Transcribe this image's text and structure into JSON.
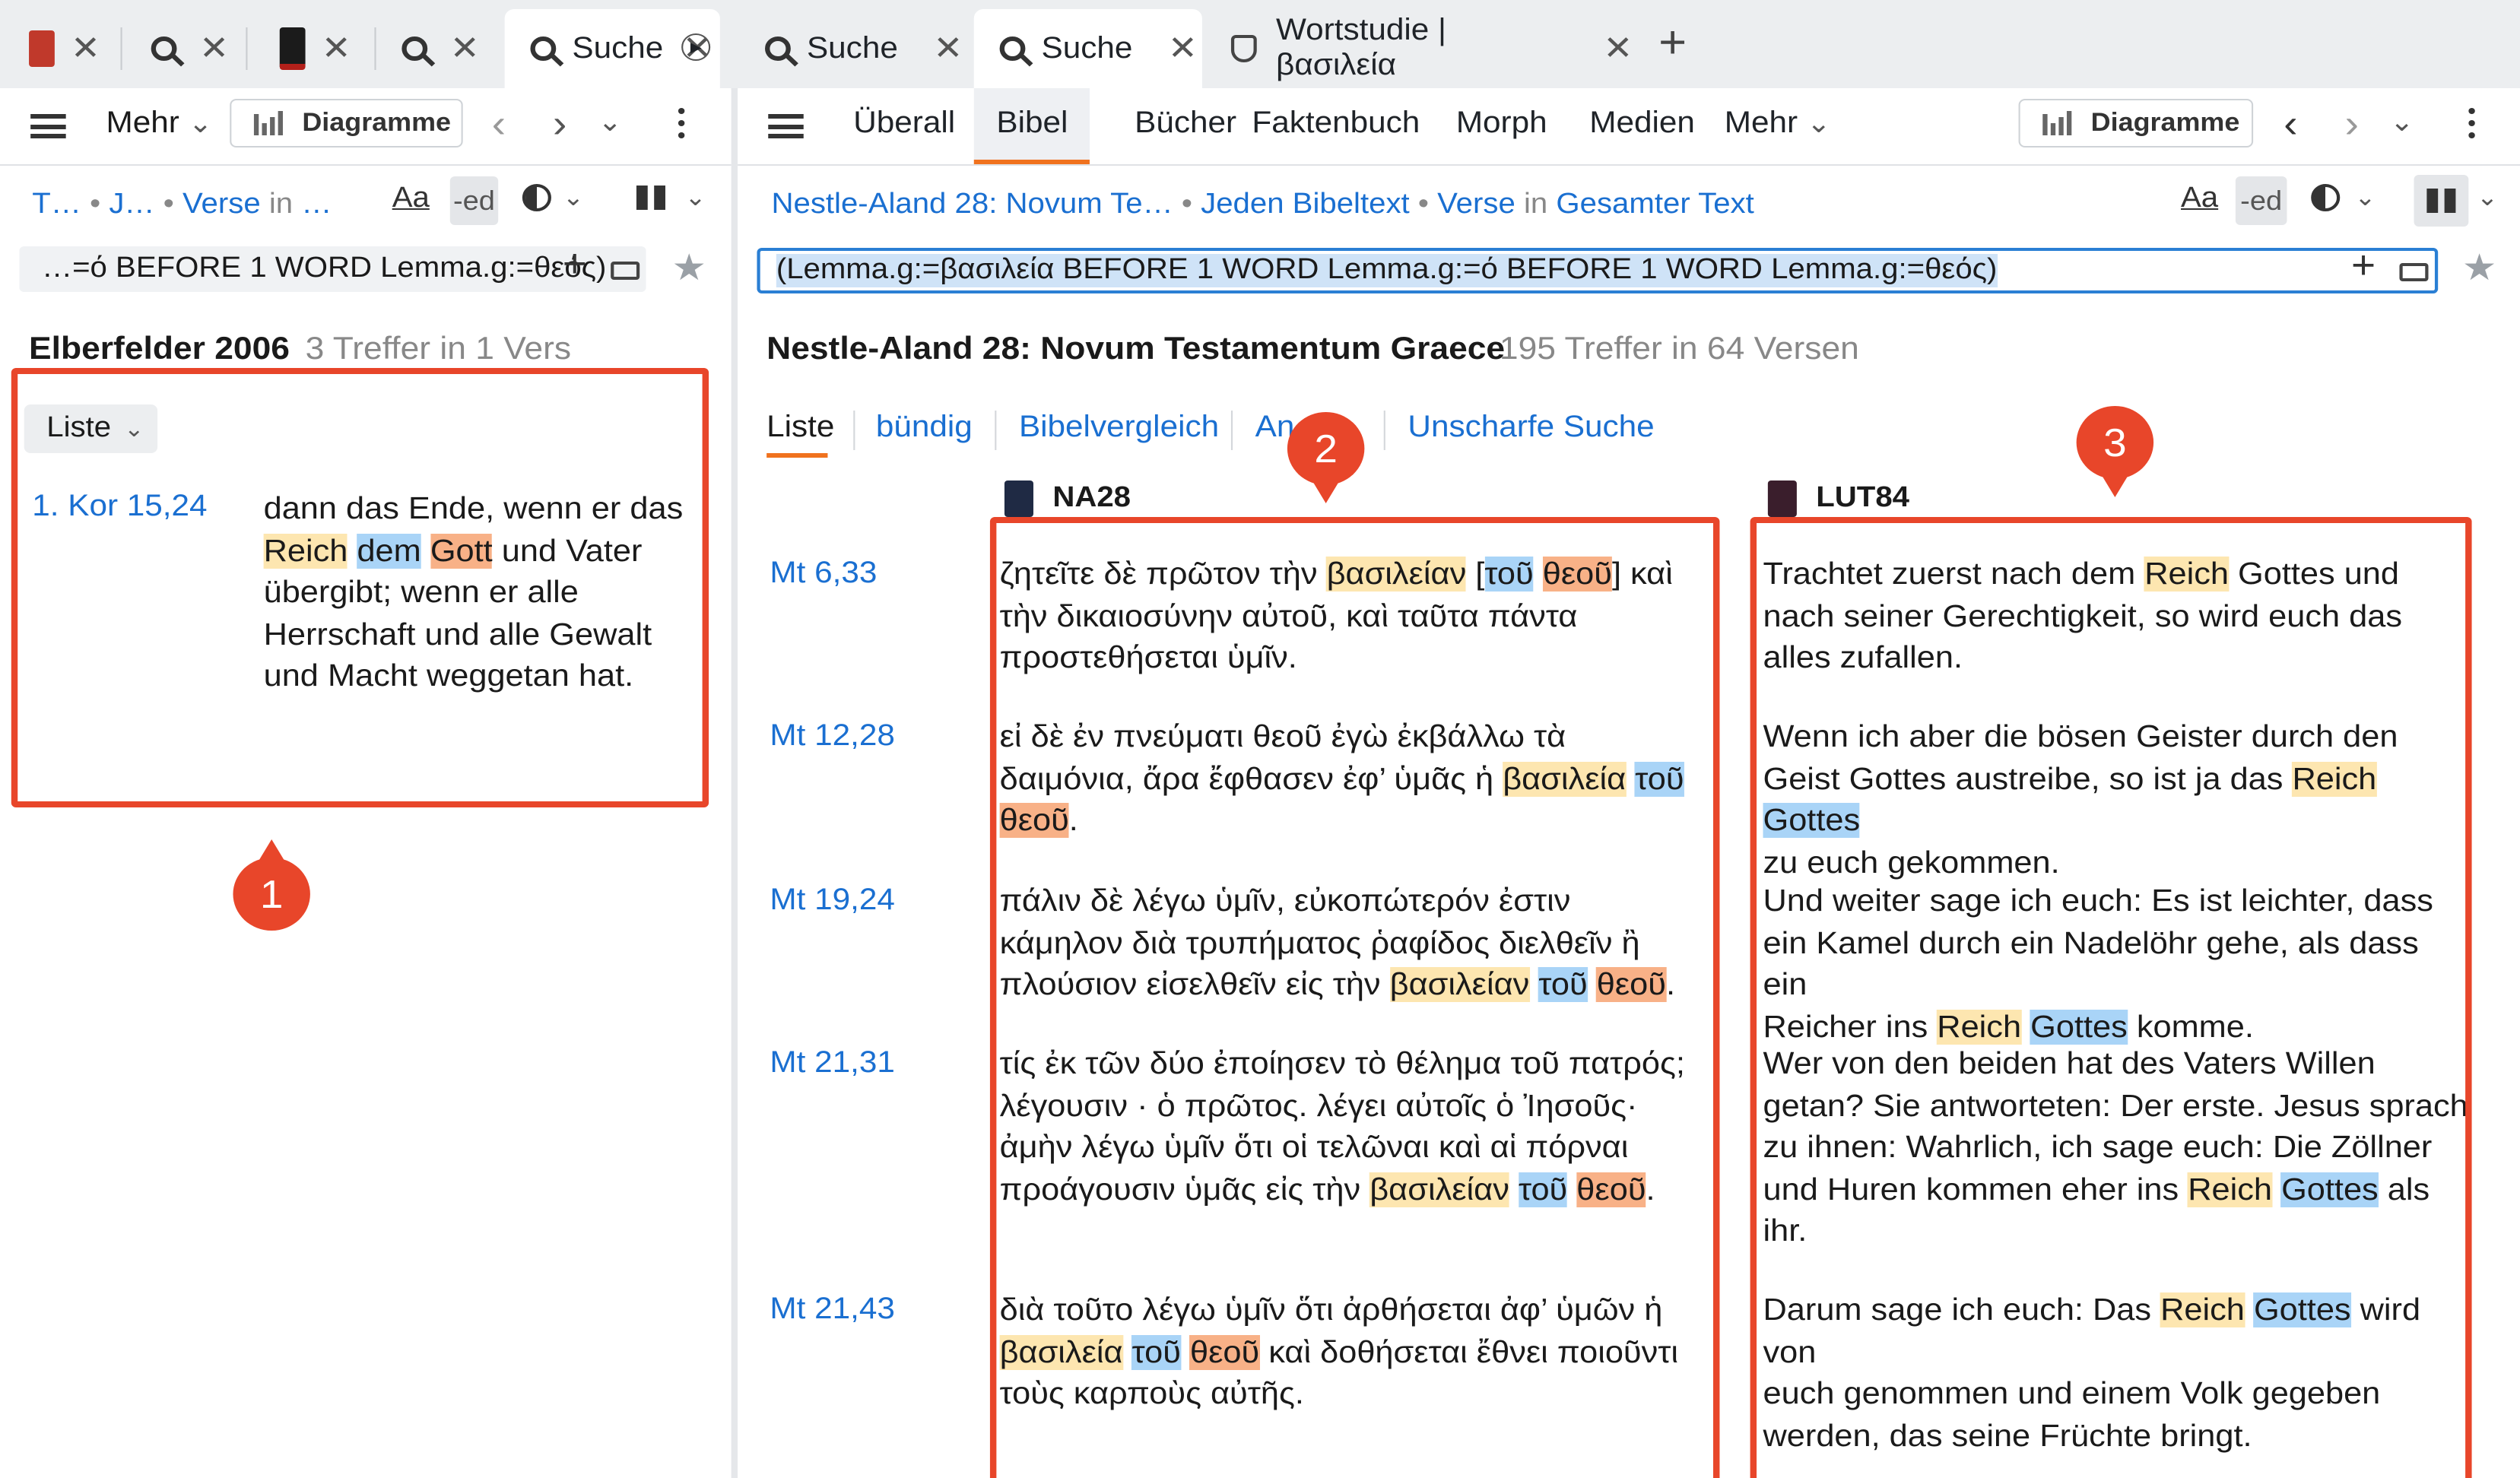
{
  "tabs": {
    "t5_label": "Suche",
    "t6_label": "Suche",
    "t7_label": "Suche",
    "t8_label": "Wortstudie | βασιλεία"
  },
  "left": {
    "toolbar": {
      "mehr": "Mehr",
      "diagramme": "Diagramme"
    },
    "breadcrumb": {
      "a": "T…",
      "b": "J…",
      "c": "Verse",
      "in": "in",
      "d": "…"
    },
    "query": "…=ό BEFORE 1 WORD Lemma.g:=θεός)",
    "result_title": "Elberfelder 2006",
    "result_count": "3 Treffer in 1 Vers",
    "view_button": "Liste",
    "verse_ref": "1. Kor 15,24",
    "verse": {
      "p1": "dann das Ende, wenn er das",
      "h1": "Reich",
      "h2": "dem",
      "h3": "Gott",
      "p2": " und Vater",
      "p3": "übergibt; wenn er alle",
      "p4": "Herrschaft und alle Gewalt",
      "p5": "und Macht weggetan hat."
    }
  },
  "right": {
    "toolbar": {
      "nav": [
        "Überall",
        "Bibel",
        "Bücher",
        "Faktenbuch",
        "Morph",
        "Medien",
        "Mehr"
      ],
      "diagramme": "Diagramme"
    },
    "breadcrumb": {
      "a": "Nestle-Aland 28: Novum Te…",
      "b": "Jeden Bibeltext",
      "c": "Verse",
      "in": "in",
      "d": "Gesamter Text"
    },
    "query": "(Lemma.g:=βασιλεία BEFORE 1 WORD Lemma.g:=ό BEFORE 1 WORD Lemma.g:=θεός)",
    "result_title": "Nestle-Aland 28: Novum Testamentum Graece",
    "result_count": "195 Treffer in 64 Versen",
    "subtabs": [
      "Liste",
      "bündig",
      "Bibelvergleich",
      "An",
      "Unscharfe Suche"
    ],
    "col1": "NA28",
    "col2": "LUT84",
    "rows": [
      {
        "ref": "Mt 6,33"
      },
      {
        "ref": "Mt 12,28"
      },
      {
        "ref": "Mt 19,24"
      },
      {
        "ref": "Mt 21,31"
      },
      {
        "ref": "Mt 21,43"
      }
    ],
    "greek": {
      "r1a": "ζητεῖτε δὲ πρῶτον τὴν ",
      "r1h1": "βασιλείαν",
      "r1b": " [",
      "r1h2": "τοῦ",
      "r1h3": "θεοῦ",
      "r1c": "] καὶ",
      "r1l2": "τὴν δικαιοσύνην αὐτοῦ, καὶ ταῦτα πάντα",
      "r1l3": "προστεθήσεται ὑμῖν.",
      "r2l1": "εἰ δὲ ἐν πνεύματι θεοῦ ἐγὼ ἐκβάλλω τὰ",
      "r2a": "δαιμόνια, ἄρα ἔφθασεν ἐφ’ ὑμᾶς ἡ ",
      "r2h1": "βασιλεία",
      "r2h2": "τοῦ",
      "r2h3": "θεοῦ",
      "r2c": ".",
      "r3l1": "πάλιν δὲ λέγω ὑμῖν, εὐκοπώτερόν ἐστιν",
      "r3l2": "κάμηλον διὰ τρυπήματος ῥαφίδος διελθεῖν ἢ",
      "r3a": "πλούσιον εἰσελθεῖν εἰς τὴν ",
      "r3h1": "βασιλείαν",
      "r3h2": "τοῦ",
      "r3h3": "θεοῦ",
      "r3c": ".",
      "r4l1": "τίς ἐκ τῶν δύο ἐποίησεν τὸ θέλημα τοῦ πατρός;",
      "r4l2": "λέγουσιν · ὁ πρῶτος. λέγει αὐτοῖς ὁ Ἰησοῦς·",
      "r4l3": "ἀμὴν λέγω ὑμῖν ὅτι οἱ τελῶναι καὶ αἱ πόρναι",
      "r4a": "προάγουσιν ὑμᾶς εἰς τὴν ",
      "r4h1": "βασιλείαν",
      "r4h2": "τοῦ",
      "r4h3": "θεοῦ",
      "r4c": ".",
      "r5l1": "διὰ τοῦτο λέγω ὑμῖν ὅτι ἀρθήσεται ἀφ’ ὑμῶν ἡ",
      "r5h1": "βασιλεία",
      "r5h2": "τοῦ",
      "r5h3": "θεοῦ",
      "r5a": " καὶ δοθήσεται ἔθνει ποιοῦντι",
      "r5l3": "τοὺς καρποὺς αὐτῆς."
    },
    "german": {
      "r1a": "Trachtet zuerst nach dem ",
      "r1h1": "Reich",
      "r1b": " Gottes und",
      "r1l2": "nach seiner Gerechtigkeit, so wird euch das",
      "r1l3": "alles zufallen.",
      "r2l1": "Wenn ich aber die bösen Geister durch den",
      "r2a": "Geist Gottes austreibe, so ist ja das ",
      "r2h1": "Reich",
      "r2h2": "Gottes",
      "r2l3": "zu euch gekommen.",
      "r3l1": "Und weiter sage ich euch: Es ist leichter, dass",
      "r3l2": "ein Kamel durch ein Nadelöhr gehe, als dass ein",
      "r3a": "Reicher ins ",
      "r3h1": "Reich",
      "r3h2": "Gottes",
      "r3b": " komme.",
      "r4l1": "Wer von den beiden hat des Vaters Willen",
      "r4l2": "getan? Sie antworteten: Der erste. Jesus sprach",
      "r4l3": "zu ihnen: Wahrlich, ich sage euch: Die Zöllner",
      "r4a": "und Huren kommen eher ins ",
      "r4h1": "Reich",
      "r4h2": "Gottes",
      "r4b": " als",
      "r4l5": "ihr.",
      "r5a": "Darum sage ich euch: Das ",
      "r5h1": "Reich",
      "r5h2": "Gottes",
      "r5b": " wird von",
      "r5l2": "euch genommen und einem Volk gegeben",
      "r5l3": "werden, das seine Früchte bringt."
    }
  },
  "markers": [
    "1",
    "2",
    "3"
  ],
  "colors": {
    "accent": "#f0721e",
    "link": "#1a6fd1",
    "annotation": "#e8462a",
    "hl_yellow": "#fde6b0",
    "hl_blue": "#a9d4f7",
    "hl_orange": "#f8b187"
  }
}
